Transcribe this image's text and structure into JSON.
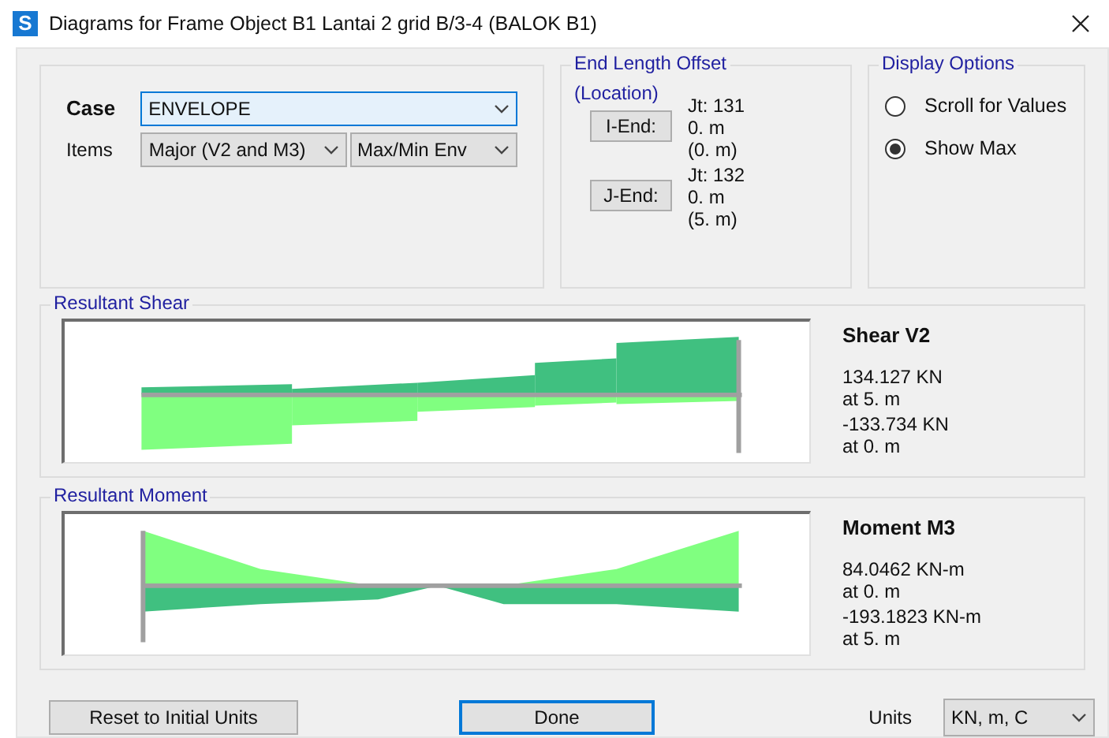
{
  "window": {
    "title": "Diagrams for Frame Object B1 Lantai 2 grid B/3-4  (BALOK B1)",
    "app_letter": "S"
  },
  "case": {
    "label": "Case",
    "value": "ENVELOPE"
  },
  "items": {
    "label": "Items",
    "component": "Major (V2 and M3)",
    "envelope": "Max/Min Env"
  },
  "end_length_offset": {
    "title": "End Length Offset",
    "subtitle": "(Location)",
    "ends": [
      {
        "button": "I-End:",
        "joint": "Jt:  131",
        "offset": "0. m",
        "location": "(0. m)"
      },
      {
        "button": "J-End:",
        "joint": "Jt:  132",
        "offset": "0. m",
        "location": "(5. m)"
      }
    ]
  },
  "display_options": {
    "title": "Display Options",
    "options": [
      {
        "label": "Scroll for Values",
        "selected": false
      },
      {
        "label": "Show Max",
        "selected": true
      }
    ]
  },
  "panels": [
    {
      "kind": "shear",
      "title": "Resultant Shear",
      "heading": "Shear V2",
      "max_value": "134.127 KN",
      "max_at": "at 5. m",
      "min_value": "-133.734 KN",
      "min_at": "at 0. m"
    },
    {
      "kind": "moment",
      "title": "Resultant Moment",
      "heading": "Moment M3",
      "max_value": "84.0462 KN-m",
      "max_at": "at 0. m",
      "min_value": "-193.1823 KN-m",
      "min_at": "at 5. m"
    }
  ],
  "buttons": {
    "reset": "Reset to Initial Units",
    "done": "Done"
  },
  "units": {
    "label": "Units",
    "value": "KN, m, C"
  }
}
